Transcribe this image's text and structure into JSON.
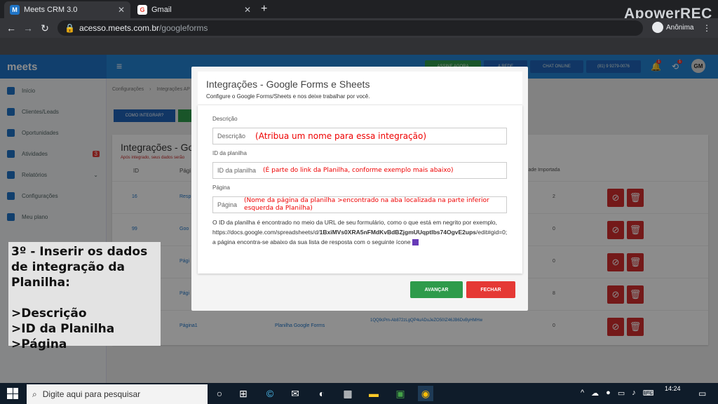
{
  "browser": {
    "tabs": [
      {
        "label": "Meets CRM 3.0",
        "favicon": "M"
      },
      {
        "label": "Gmail",
        "favicon": "G"
      }
    ],
    "new_tab": "+",
    "url_host": "acesso.meets.com.br",
    "url_path": "/googleforms",
    "profile": "Anônima",
    "watermark": "ApowerREC"
  },
  "app": {
    "logo": "meets",
    "menu_icon": "≡",
    "top_buttons": [
      "ASSINE AGORA",
      "A REDE",
      "CHAT ONLINE",
      "(81) 9 9279-0076"
    ],
    "badges": [
      "1",
      "1"
    ],
    "avatar": "GM",
    "sidebar": [
      {
        "label": "Início"
      },
      {
        "label": "Clientes/Leads"
      },
      {
        "label": "Oportunidades"
      },
      {
        "label": "Atividades",
        "badge": "3"
      },
      {
        "label": "Relatórios"
      },
      {
        "label": "Configurações"
      },
      {
        "label": "Meu plano"
      }
    ],
    "breadcrumb": [
      "Configurações",
      "Integrações AP"
    ],
    "buttons": {
      "como_integrar": "COMO INTEGRAR?"
    },
    "section_title": "Integrações - Go",
    "section_note": "Após integrado, seus dados serão",
    "table": {
      "headers": [
        "ID",
        "Pági",
        "idade Importada"
      ],
      "rows": [
        {
          "id": "16",
          "page": "Resp",
          "count": "2"
        },
        {
          "id": "99",
          "page": "Goo",
          "count": "0"
        },
        {
          "id": "",
          "page": "Pági",
          "count": "0"
        },
        {
          "id": "",
          "page": "Pági",
          "count": "8"
        },
        {
          "id": "",
          "page": "Página1",
          "sheet": "Planilha Google Forms",
          "sheet_id": "1QQ9cPm-Ab872zLgQP4uADuJeZO50IZ46JB6DvByHMHw",
          "count": "0"
        }
      ]
    }
  },
  "modal": {
    "title": "Integrações - Google Forms e Sheets",
    "subtitle": "Configure o Google Forms/Sheets e nos deixe trabalhar por você.",
    "fields": [
      {
        "label": "Descrição",
        "placeholder": "Descrição",
        "note": "(Atribua um nome para essa integração)"
      },
      {
        "label": "ID da planilha",
        "placeholder": "ID da planilha",
        "note": "(É parte do link da Planilha, conforme exemplo mais abaixo)"
      },
      {
        "label": "Página",
        "placeholder": "Página",
        "note": "(Nome da página da planilha >encontrado na aba localizada na parte inferior esquerda da Planilha)"
      }
    ],
    "help_1": "O ID da planilha é encontrado no meio da URL de seu formulário, como o que está em negrito por exemplo,",
    "help_url_a": "https://docs.google.com/spreadsheets/d/",
    "help_url_b": "1BxiMVs0XRA5nFMdKvBdBZjgmUUqptlbs74OgvE2ups",
    "help_url_c": "/edit#gid=0;",
    "help_2": "a página encontra-se abaixo da sua lista de resposta com o seguinte ícone",
    "btn_ok": "AVANÇAR",
    "btn_cancel": "FECHAR"
  },
  "note": {
    "title": "3º - Inserir os dados de integração da Planilha:",
    "items": [
      ">Descrição",
      ">ID da Planilha",
      ">Página"
    ]
  },
  "taskbar": {
    "search": "Digite aqui para pesquisar",
    "time": "14:24"
  }
}
